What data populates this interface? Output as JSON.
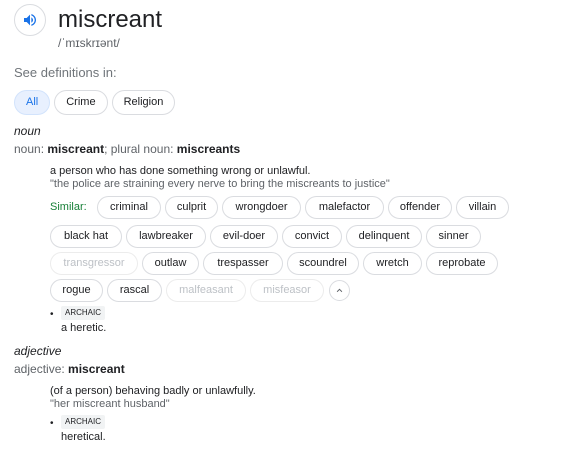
{
  "headword": {
    "word": "miscreant",
    "pronunciation": "/ˈmɪskrɪənt/"
  },
  "see_definitions": {
    "label": "See definitions in:",
    "chips": [
      {
        "label": "All",
        "active": true
      },
      {
        "label": "Crime",
        "active": false
      },
      {
        "label": "Religion",
        "active": false
      }
    ]
  },
  "noun": {
    "pos": "noun",
    "line_prefix": "noun: ",
    "word": "miscreant",
    "plural_label": "; plural noun: ",
    "plural": "miscreants",
    "definition": "a person who has done something wrong or unlawful.",
    "example": "\"the police are straining every nerve to bring the miscreants to justice\"",
    "similar_label": "Similar:",
    "similar": [
      {
        "label": "criminal",
        "faded": false
      },
      {
        "label": "culprit",
        "faded": false
      },
      {
        "label": "wrongdoer",
        "faded": false
      },
      {
        "label": "malefactor",
        "faded": false
      },
      {
        "label": "offender",
        "faded": false
      },
      {
        "label": "villain",
        "faded": false
      },
      {
        "label": "black hat",
        "faded": false
      },
      {
        "label": "lawbreaker",
        "faded": false
      },
      {
        "label": "evil-doer",
        "faded": false
      },
      {
        "label": "convict",
        "faded": false
      },
      {
        "label": "delinquent",
        "faded": false
      },
      {
        "label": "sinner",
        "faded": false
      },
      {
        "label": "transgressor",
        "faded": true
      },
      {
        "label": "outlaw",
        "faded": false
      },
      {
        "label": "trespasser",
        "faded": false
      },
      {
        "label": "scoundrel",
        "faded": false
      },
      {
        "label": "wretch",
        "faded": false
      },
      {
        "label": "reprobate",
        "faded": false
      },
      {
        "label": "rogue",
        "faded": false
      },
      {
        "label": "rascal",
        "faded": false
      },
      {
        "label": "malfeasant",
        "faded": true
      },
      {
        "label": "misfeasor",
        "faded": true
      }
    ],
    "sub_bullet": "•",
    "sub_tag": "ARCHAIC",
    "sub_definition": "a heretic."
  },
  "adjective": {
    "pos": "adjective",
    "line_prefix": "adjective: ",
    "word": "miscreant",
    "definition": "(of a person) behaving badly or unlawfully.",
    "example": "\"her miscreant husband\"",
    "sub_bullet": "•",
    "sub_tag": "ARCHAIC",
    "sub_definition": "heretical."
  },
  "icons": {
    "speaker": "speaker-icon",
    "collapse": "chevron-up-icon"
  },
  "colors": {
    "accent": "#1a73e8",
    "similar": "#188038",
    "muted": "#5f6368"
  }
}
